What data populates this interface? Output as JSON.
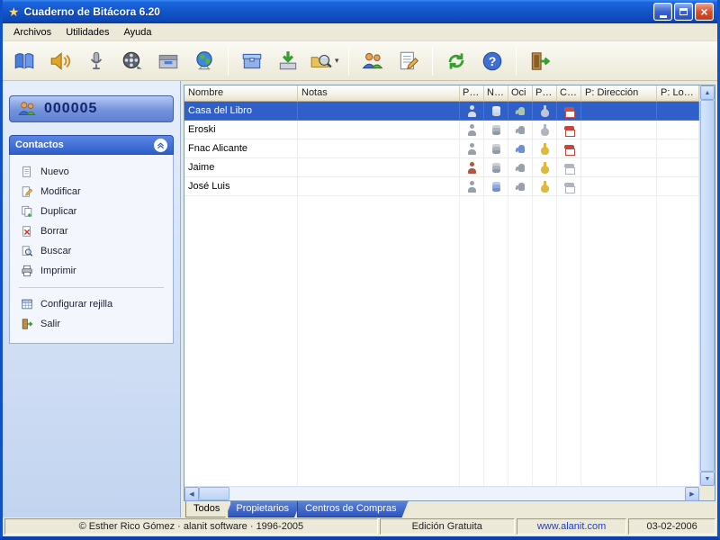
{
  "window": {
    "title": "Cuaderno de Bitácora 6.20"
  },
  "menubar": {
    "items": [
      {
        "label": "Archivos"
      },
      {
        "label": "Utilidades"
      },
      {
        "label": "Ayuda"
      }
    ]
  },
  "toolbar": {
    "buttons": [
      {
        "icon": "book"
      },
      {
        "icon": "audio"
      },
      {
        "icon": "microphone"
      },
      {
        "icon": "film"
      },
      {
        "icon": "archive"
      },
      {
        "icon": "globe"
      },
      {
        "sep": true
      },
      {
        "icon": "package"
      },
      {
        "icon": "import"
      },
      {
        "icon": "search",
        "dropdown": true
      },
      {
        "sep": true
      },
      {
        "icon": "contacts"
      },
      {
        "icon": "notes"
      },
      {
        "sep": true
      },
      {
        "icon": "refresh"
      },
      {
        "icon": "help"
      },
      {
        "sep": true
      },
      {
        "icon": "exit"
      }
    ]
  },
  "sidebar": {
    "counter": "000005",
    "panel_title": "Contactos",
    "items": [
      {
        "icon": "new",
        "label": "Nuevo"
      },
      {
        "icon": "edit",
        "label": "Modificar"
      },
      {
        "icon": "copy",
        "label": "Duplicar"
      },
      {
        "icon": "delete",
        "label": "Borrar"
      },
      {
        "icon": "find",
        "label": "Buscar"
      },
      {
        "icon": "print",
        "label": "Imprimir"
      },
      {
        "divider": true
      },
      {
        "icon": "grid",
        "label": "Configurar rejilla"
      },
      {
        "icon": "exit-small",
        "label": "Salir"
      }
    ]
  },
  "table": {
    "columns": [
      {
        "key": "nombre",
        "label": "Nombre"
      },
      {
        "key": "notas",
        "label": "Notas"
      },
      {
        "key": "pers",
        "label": "Pers"
      },
      {
        "key": "neg",
        "label": "Neg"
      },
      {
        "key": "oci",
        "label": "Oci"
      },
      {
        "key": "prop",
        "label": "Prop"
      },
      {
        "key": "con",
        "label": "Con"
      },
      {
        "key": "dir",
        "label": "P: Dirección"
      },
      {
        "key": "loc",
        "label": "P: Localidad"
      }
    ],
    "rows": [
      {
        "name": "Casa del Libro",
        "notas": "",
        "selected": true,
        "icons": [
          {
            "name": "person",
            "color": "#d8dde8"
          },
          {
            "name": "db",
            "color": "#c8d2e4"
          },
          {
            "name": "hand",
            "color": "#aac4b0"
          },
          {
            "name": "bag",
            "color": "#c0c6d4"
          },
          {
            "name": "shop",
            "color": "#d05040"
          }
        ]
      },
      {
        "name": "Eroski",
        "notas": "",
        "selected": false,
        "icons": [
          {
            "name": "person",
            "color": "#9aa0aa"
          },
          {
            "name": "db",
            "color": "#8f99a8"
          },
          {
            "name": "hand",
            "color": "#9aa0aa"
          },
          {
            "name": "bag",
            "color": "#b0b4bd"
          },
          {
            "name": "shop",
            "color": "#c8453a"
          }
        ]
      },
      {
        "name": "Fnac Alicante",
        "notas": "",
        "selected": false,
        "icons": [
          {
            "name": "person",
            "color": "#9aa0aa"
          },
          {
            "name": "db",
            "color": "#8f99a8"
          },
          {
            "name": "hand",
            "color": "#6d8fd4"
          },
          {
            "name": "bag",
            "color": "#e0b93c"
          },
          {
            "name": "shop",
            "color": "#c8453a"
          }
        ]
      },
      {
        "name": "Jaime",
        "notas": "",
        "selected": false,
        "icons": [
          {
            "name": "person",
            "color": "#b5543f"
          },
          {
            "name": "db",
            "color": "#8f99a8"
          },
          {
            "name": "hand",
            "color": "#9aa0aa"
          },
          {
            "name": "bag",
            "color": "#e0b93c"
          },
          {
            "name": "shop",
            "color": "#b0b4bd"
          }
        ]
      },
      {
        "name": "José Luis",
        "notas": "",
        "selected": false,
        "icons": [
          {
            "name": "person",
            "color": "#9aa0aa"
          },
          {
            "name": "db",
            "color": "#6d8fd4"
          },
          {
            "name": "hand",
            "color": "#9aa0aa"
          },
          {
            "name": "bag",
            "color": "#e0b93c"
          },
          {
            "name": "shop",
            "color": "#b0b4bd"
          }
        ]
      }
    ]
  },
  "tabs": [
    {
      "label": "Todos",
      "active": true
    },
    {
      "label": "Propietarios",
      "active": false
    },
    {
      "label": "Centros de Compras",
      "active": false
    }
  ],
  "statusbar": {
    "copyright": "© Esther Rico Gómez · alanit software · 1996-2005",
    "edition": "Edición Gratuita",
    "website": "www.alanit.com",
    "date": "03-02-2006"
  },
  "colors": {
    "titlebar": "#1557cc",
    "selection": "#2f5fc8",
    "panel_header": "#3a6ad0",
    "link": "#1a3ecc",
    "chrome": "#ece9d8"
  }
}
